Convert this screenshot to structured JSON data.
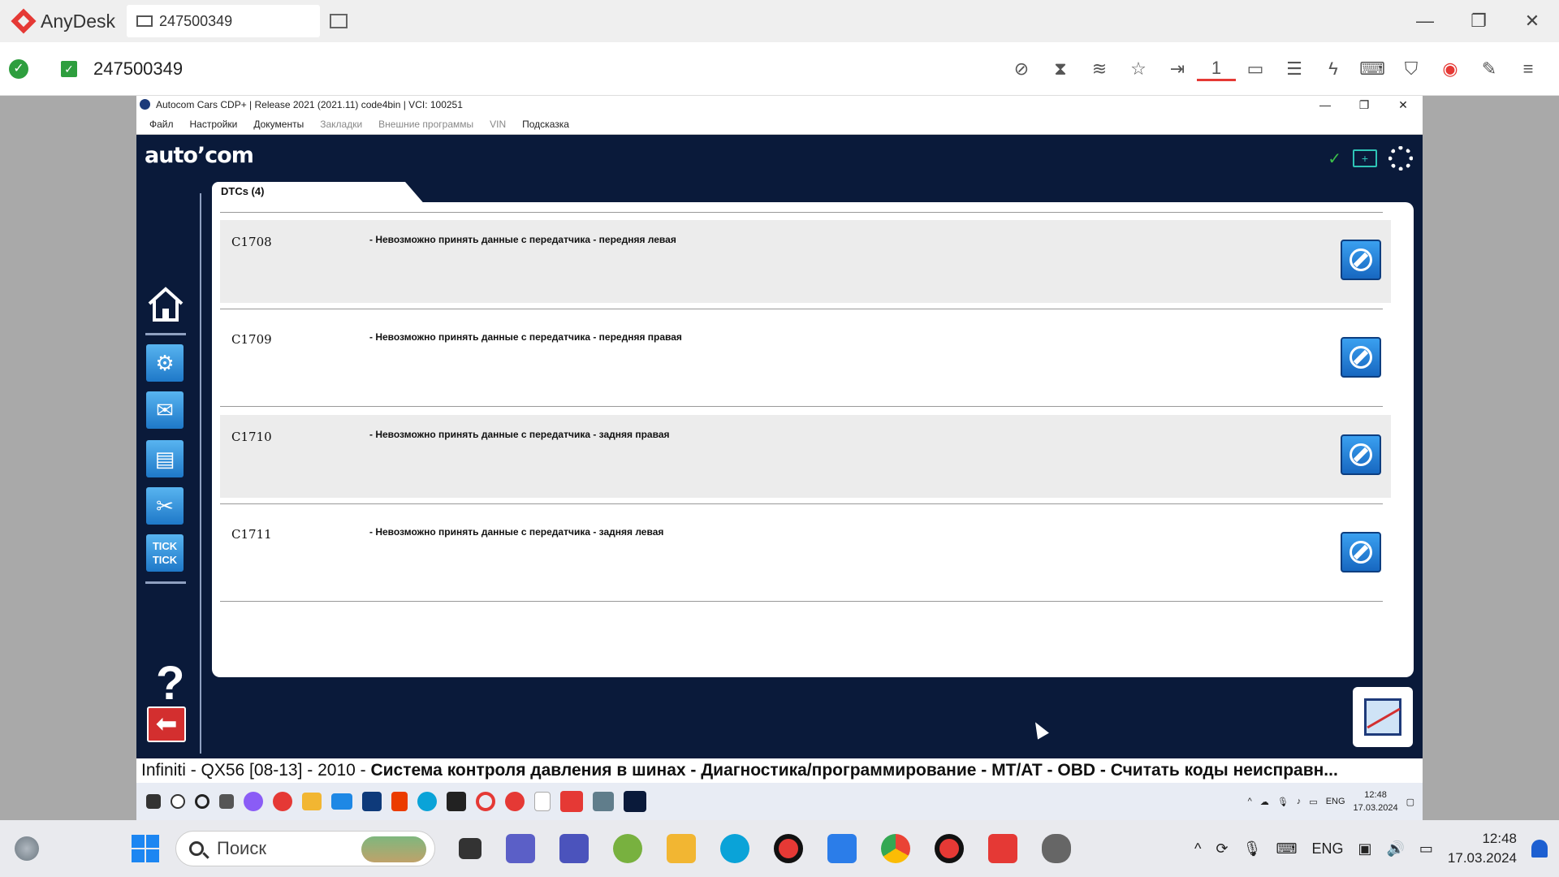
{
  "anydesk": {
    "app_name": "AnyDesk",
    "tab_label": "247500349",
    "address": "247500349",
    "window_controls": [
      "—",
      "❐",
      "✕"
    ],
    "toolbar_icons": [
      "privacy-icon",
      "hourglass-icon",
      "database-icon",
      "star-icon",
      "file-transfer-icon",
      "monitor-1-icon",
      "display-icon",
      "chat-icon",
      "lightning-icon",
      "keyboard-icon",
      "shield-icon",
      "record-icon",
      "pen-icon",
      "menu-icon"
    ],
    "monitor_number": "1"
  },
  "autocom": {
    "window_title": "Autocom Cars CDP+ | Release 2021 (2021.11) code4bin | VCI: 100251",
    "window_controls": [
      "—",
      "❐",
      "✕"
    ],
    "menu": [
      {
        "label": "Файл",
        "enabled": true
      },
      {
        "label": "Настройки",
        "enabled": true
      },
      {
        "label": "Документы",
        "enabled": true
      },
      {
        "label": "Закладки",
        "enabled": false
      },
      {
        "label": "Внешние программы",
        "enabled": false
      },
      {
        "label": "VIN",
        "enabled": false
      },
      {
        "label": "Подсказка",
        "enabled": true
      }
    ],
    "logo": "auto’com",
    "tab_label": "DTCs (4)",
    "help_glyph": "?",
    "back_glyph": "⬅",
    "sidebar_tick_label_1": "TICK",
    "sidebar_tick_label_2": "TICK",
    "dtcs": [
      {
        "code": "C1708",
        "description": "- Невозможно принять данные с передатчика - передняя левая"
      },
      {
        "code": "C1709",
        "description": "- Невозможно принять данные с передатчика - передняя правая"
      },
      {
        "code": "C1710",
        "description": "- Невозможно принять данные с передатчика - задняя правая"
      },
      {
        "code": "C1711",
        "description": "- Невозможно принять данные с передатчика - задняя левая"
      }
    ],
    "status_prefix": "Infiniti - QX56 [08-13] - 2010 - ",
    "status_bold": "Система контроля давления в шинах - Диагностика/программирование - MT/AT - OBD - Считать коды неисправн..."
  },
  "remote_taskbar": {
    "tray_lang": "ENG",
    "time": "12:48",
    "date": "17.03.2024"
  },
  "taskbar": {
    "search_placeholder": "Поиск",
    "lang": "ENG",
    "time": "12:48",
    "date": "17.03.2024"
  },
  "colors": {
    "anydesk_red": "#e53935",
    "autocom_navy": "#0a1a3a",
    "button_blue": "#1e78c8"
  }
}
